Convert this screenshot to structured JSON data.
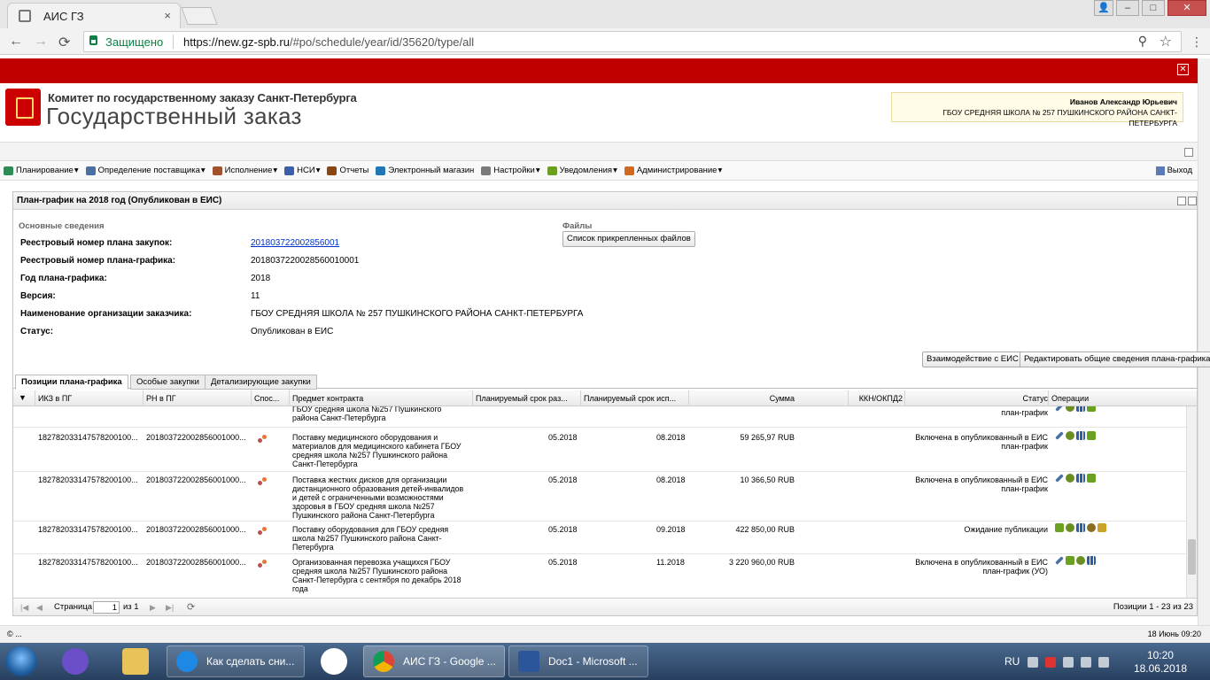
{
  "browser": {
    "tab_title": "АИС ГЗ",
    "tab_close": "×",
    "secure_label": "Защищено",
    "url_host": "https://new.gz-spb.ru",
    "url_path": "/#po/schedule/year/id/35620/type/all",
    "back": "←",
    "forward": "→",
    "reload": "⟳",
    "zoom": "⚲",
    "star": "☆",
    "menu": "⋮",
    "win_min": "–",
    "win_max": "□",
    "win_close": "✕",
    "win_user": "👤"
  },
  "app": {
    "close_banner": "✕",
    "org_small": "Комитет по государственному заказу Санкт-Петербурга",
    "org_big": "Государственный заказ",
    "user_name": "Иванов Александр Юрьевич",
    "user_org": "ГБОУ СРЕДНЯЯ ШКОЛА № 257 ПУШКИНСКОГО РАЙОНА САНКТ-ПЕТЕРБУРГА"
  },
  "menu": {
    "items": [
      {
        "label": "Планирование",
        "color": "#2e8b57"
      },
      {
        "label": "Определение поставщика",
        "color": "#4a6fa5"
      },
      {
        "label": "Исполнение",
        "color": "#a0522d"
      },
      {
        "label": "НСИ",
        "color": "#3b5fa8"
      },
      {
        "label": "Отчеты",
        "color": "#8b4513"
      },
      {
        "label": "Электронный магазин",
        "color": "#1f77b4"
      },
      {
        "label": "Настройки",
        "color": "#7a7a7a"
      },
      {
        "label": "Уведомления",
        "color": "#6aa121"
      },
      {
        "label": "Администрирование",
        "color": "#d2691e"
      }
    ],
    "dropdown_flags": [
      true,
      true,
      true,
      true,
      false,
      false,
      true,
      true,
      true
    ],
    "caret": "▾",
    "exit": "Выход"
  },
  "panel": {
    "title": "План-график на 2018 год (Опубликован в ЕИС)",
    "section_main": "Основные сведения",
    "section_files": "Файлы",
    "files_button": "Список прикрепленных файлов",
    "fields": [
      {
        "label": "Реестровый номер плана закупок:",
        "value": "201803722002856001"
      },
      {
        "label": "Реестровый номер плана-графика:",
        "value": "2018037220028560010001"
      },
      {
        "label": "Год плана-графика:",
        "value": "2018"
      },
      {
        "label": "Версия:",
        "value": "11"
      },
      {
        "label": "Наименование организации заказчика:",
        "value": "ГБОУ СРЕДНЯЯ ШКОЛА № 257 ПУШКИНСКОГО РАЙОНА САНКТ-ПЕТЕРБУРГА"
      },
      {
        "label": "Статус:",
        "value": "Опубликован в ЕИС"
      }
    ],
    "btn_eis": "Взаимодействие с ЕИС",
    "btn_edit": "Редактировать общие сведения плана-графика"
  },
  "tabs": [
    "Позиции плана-графика",
    "Особые закупки",
    "Детализирующие закупки"
  ],
  "grid": {
    "columns": [
      "ИКЗ в ПГ",
      "РН в ПГ",
      "Спос...",
      "Предмет контракта",
      "Планируемый срок раз...",
      "Планируемый срок исп...",
      "Сумма",
      "ККН/ОКПД2",
      "Статус",
      "Операции"
    ],
    "partial_row": {
      "subject": "ГБОУ средняя школа №257 Пушкинского района Санкт-Петербурга",
      "status": "план-график"
    },
    "rows": [
      {
        "ikz": "182782033147578200100...",
        "rn": "201803722002856001000...",
        "subject": "Поставку медицинского оборудования и материалов для медицинского кабинета ГБОУ средняя школа №257 Пушкинского района Санкт-Петербурга",
        "start": "05.2018",
        "end": "08.2018",
        "sum": "59 265,97 RUB",
        "status_line1": "Включена в опубликованный в ЕИС",
        "status_line2": "план-график",
        "ops": [
          "pen",
          "gear",
          "chart",
          "ok"
        ]
      },
      {
        "ikz": "182782033147578200100...",
        "rn": "201803722002856001000...",
        "subject": "Поставка жестких дисков для организации дистанционного образования детей-инвалидов и детей с ограниченными возможностями здоровья в ГБОУ средняя школа №257 Пушкинского района Санкт-Петербурга",
        "start": "05.2018",
        "end": "08.2018",
        "sum": "10 366,50 RUB",
        "status_line1": "Включена в опубликованный в ЕИС",
        "status_line2": "план-график",
        "ops": [
          "pen",
          "gear",
          "chart",
          "ok"
        ]
      },
      {
        "ikz": "182782033147578200100...",
        "rn": "201803722002856001000...",
        "subject": "Поставку оборудования для ГБОУ средняя школа №257 Пушкинского района Санкт-Петербурга",
        "start": "05.2018",
        "end": "09.2018",
        "sum": "422 850,00 RUB",
        "status_line1": "Ожидание публикации",
        "status_line2": "",
        "ops": [
          "ok",
          "gear",
          "chart",
          "gear2",
          "doc"
        ]
      },
      {
        "ikz": "182782033147578200100...",
        "rn": "201803722002856001000...",
        "subject": "Организованная перевозка учащихся ГБОУ средняя школа №257 Пушкинского района Санкт-Петербурга с сентября по декабрь 2018 года",
        "start": "05.2018",
        "end": "11.2018",
        "sum": "3 220 960,00 RUB",
        "status_line1": "Включена в опубликованный в ЕИС",
        "status_line2": "план-график (УО)",
        "ops": [
          "pen",
          "ok",
          "gear",
          "chart"
        ]
      }
    ]
  },
  "pager": {
    "first": "|◀",
    "prev": "◀",
    "label": "Страница",
    "page": "1",
    "of": "из 1",
    "next": "▶",
    "last": "▶|",
    "refresh": "⟳",
    "summary": "Позиции 1 - 23 из 23"
  },
  "status": {
    "left": "© ...",
    "right": "18 Июнь 09:20"
  },
  "taskbar": {
    "buttons": [
      {
        "label": "Как сделать сни...",
        "color": "#1e88e5"
      },
      {
        "label": "АИС ГЗ - Google ...",
        "color": "#db4437"
      },
      {
        "label": "Doc1 - Microsoft ...",
        "color": "#2b579a"
      }
    ],
    "lang": "RU",
    "time": "10:20",
    "date": "18.06.2018"
  }
}
